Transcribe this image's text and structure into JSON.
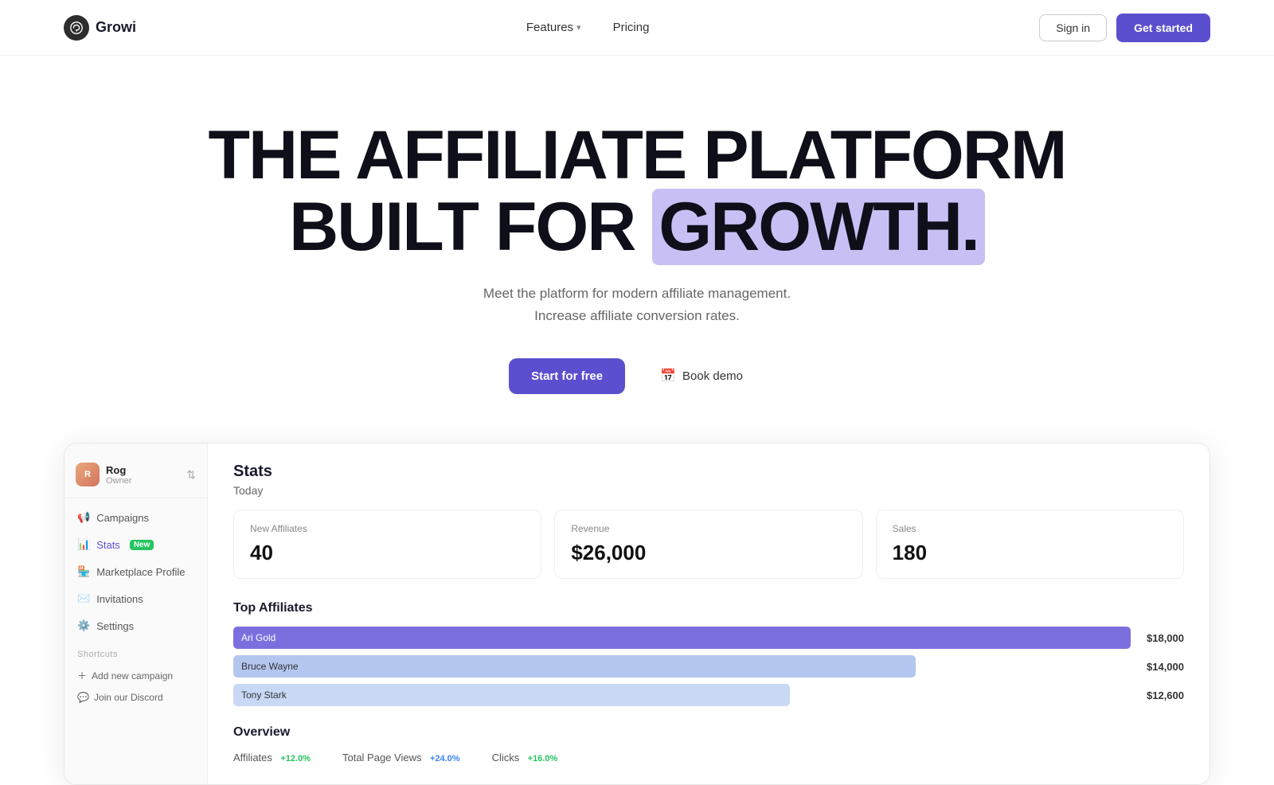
{
  "nav": {
    "logo_text": "Growi",
    "features_label": "Features",
    "pricing_label": "Pricing",
    "signin_label": "Sign in",
    "getstarted_label": "Get started"
  },
  "hero": {
    "line1": "THE AFFILIATE PLATFORM",
    "line2_pre": "BUILT FOR ",
    "line2_highlight": "GROWTH.",
    "subtitle1": "Meet the platform for modern affiliate management.",
    "subtitle2": "Increase affiliate conversion rates.",
    "cta_primary": "Start for free",
    "cta_secondary": "Book demo"
  },
  "sidebar": {
    "user_name": "Rog",
    "user_role": "Owner",
    "nav_items": [
      {
        "label": "Campaigns",
        "icon": "campaigns",
        "active": false
      },
      {
        "label": "Stats",
        "icon": "stats",
        "active": true,
        "badge": "New"
      },
      {
        "label": "Marketplace Profile",
        "icon": "marketplace",
        "active": false
      },
      {
        "label": "Invitations",
        "icon": "invitations",
        "active": false
      },
      {
        "label": "Settings",
        "icon": "settings",
        "active": false
      }
    ],
    "shortcuts_label": "Shortcuts",
    "shortcuts": [
      {
        "label": "Add new campaign",
        "icon": "plus"
      },
      {
        "label": "Join our Discord",
        "icon": "discord"
      }
    ]
  },
  "main": {
    "stats_title": "Stats",
    "today_label": "Today",
    "stat_cards": [
      {
        "label": "New Affiliates",
        "value": "40"
      },
      {
        "label": "Revenue",
        "value": "$26,000"
      },
      {
        "label": "Sales",
        "value": "180"
      }
    ],
    "top_affiliates_title": "Top Affiliates",
    "affiliates": [
      {
        "name": "Ari Gold",
        "bar_pct": 100,
        "amount": "$18,000",
        "style": "1"
      },
      {
        "name": "Bruce Wayne",
        "bar_pct": 76,
        "amount": "$14,000",
        "style": "2"
      },
      {
        "name": "Tony Stark",
        "bar_pct": 62,
        "amount": "$12,600",
        "style": "3"
      }
    ],
    "overview_title": "Overview",
    "overview_items": [
      {
        "label": "Affiliates",
        "badge": "+12.0%",
        "badge_color": "green"
      },
      {
        "label": "Total Page Views",
        "badge": "+24.0%",
        "badge_color": "blue"
      },
      {
        "label": "Clicks",
        "badge": "+16.0%",
        "badge_color": "green"
      }
    ]
  },
  "colors": {
    "brand": "#5b4fcf",
    "highlight_bg": "#c8c0f5",
    "bar_1": "#7b6fe0",
    "bar_2": "#b3c6f0",
    "bar_3": "#c8d8f5"
  }
}
